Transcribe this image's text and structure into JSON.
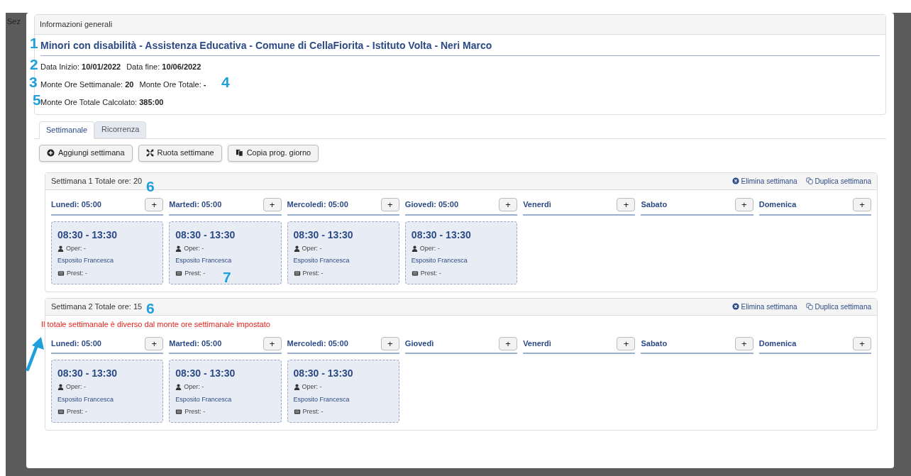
{
  "backdrop": {
    "text": "Sez"
  },
  "info_panel": {
    "heading": "Informazioni generali",
    "title": "Minori con disabilità - Assistenza Educativa - Comune di CellaFiorita - Istituto Volta - Neri Marco",
    "lines": [
      [
        {
          "label": "Data Inizio:",
          "value": "10/01/2022"
        },
        {
          "label": "Data fine:",
          "value": "10/06/2022"
        }
      ],
      [
        {
          "label": "Monte Ore Settimanale:",
          "value": "20"
        },
        {
          "label": "Monte Ore Totale:",
          "value": "-"
        }
      ],
      [
        {
          "label": "Monte Ore Totale Calcolato:",
          "value": "385:00"
        }
      ]
    ]
  },
  "tabs": [
    {
      "label": "Settimanale",
      "selected": true
    },
    {
      "label": "Ricorrenza",
      "selected": false
    }
  ],
  "toolbar": [
    {
      "label": "Aggiungi settimana"
    },
    {
      "label": "Ruota settimane"
    },
    {
      "label": "Copia prog. giorno"
    }
  ],
  "weeks": [
    {
      "title": "Settimana 1 Totale ore: 20",
      "actions": [
        {
          "label": "Elimina settimana"
        },
        {
          "label": "Duplica settimana"
        }
      ],
      "days": [
        {
          "label": "Lunedì: 05:00",
          "add": "+",
          "slots": [
            {
              "time": "08:30 - 13:30",
              "operator": "Oper: -",
              "name": "Esposito Francesca",
              "service": "Prest: -"
            }
          ]
        },
        {
          "label": "Martedì: 05:00",
          "add": "+",
          "slots": [
            {
              "time": "08:30 - 13:30",
              "operator": "Oper: -",
              "name": "Esposito Francesca",
              "service": "Prest: -"
            }
          ]
        },
        {
          "label": "Mercoledì: 05:00",
          "add": "+",
          "slots": [
            {
              "time": "08:30 - 13:30",
              "operator": "Oper: -",
              "name": "Esposito Francesca",
              "service": "Prest: -"
            }
          ]
        },
        {
          "label": "Giovedì: 05:00",
          "add": "+",
          "slots": [
            {
              "time": "08:30 - 13:30",
              "operator": "Oper: -",
              "name": "Esposito Francesca",
              "service": "Prest: -"
            }
          ]
        },
        {
          "label": "Venerdì",
          "add": "+"
        },
        {
          "label": "Sabato",
          "add": "+"
        },
        {
          "label": "Domenica",
          "add": "+"
        }
      ]
    },
    {
      "title": "Settimana 2 Totale ore: 15",
      "warning": "Il totale settimanale è diverso dal monte ore settimanale impostato",
      "actions": [
        {
          "label": "Elimina settimana"
        },
        {
          "label": "Duplica settimana"
        }
      ],
      "days": [
        {
          "label": "Lunedì: 05:00",
          "add": "+",
          "slots": [
            {
              "time": "08:30 - 13:30",
              "operator": "Oper: -",
              "name": "Esposito Francesca",
              "service": "Prest: -"
            }
          ]
        },
        {
          "label": "Martedì: 05:00",
          "add": "+",
          "slots": [
            {
              "time": "08:30 - 13:30",
              "operator": "Oper: -",
              "name": "Esposito Francesca",
              "service": "Prest: -"
            }
          ]
        },
        {
          "label": "Mercoledì: 05:00",
          "add": "+",
          "slots": [
            {
              "time": "08:30 - 13:30",
              "operator": "Oper: -",
              "name": "Esposito Francesca",
              "service": "Prest: -"
            }
          ]
        },
        {
          "label": "Giovedì",
          "add": "+"
        },
        {
          "label": "Venerdì",
          "add": "+"
        },
        {
          "label": "Sabato",
          "add": "+"
        },
        {
          "label": "Domenica",
          "add": "+"
        }
      ]
    }
  ],
  "annotations": [
    {
      "label": "1"
    },
    {
      "label": "2"
    },
    {
      "label": "3"
    },
    {
      "label": "4"
    },
    {
      "label": "5"
    },
    {
      "label": "6"
    },
    {
      "label": "7"
    },
    {
      "label": "6"
    }
  ],
  "arrow": {
    "kind": "pointer"
  }
}
